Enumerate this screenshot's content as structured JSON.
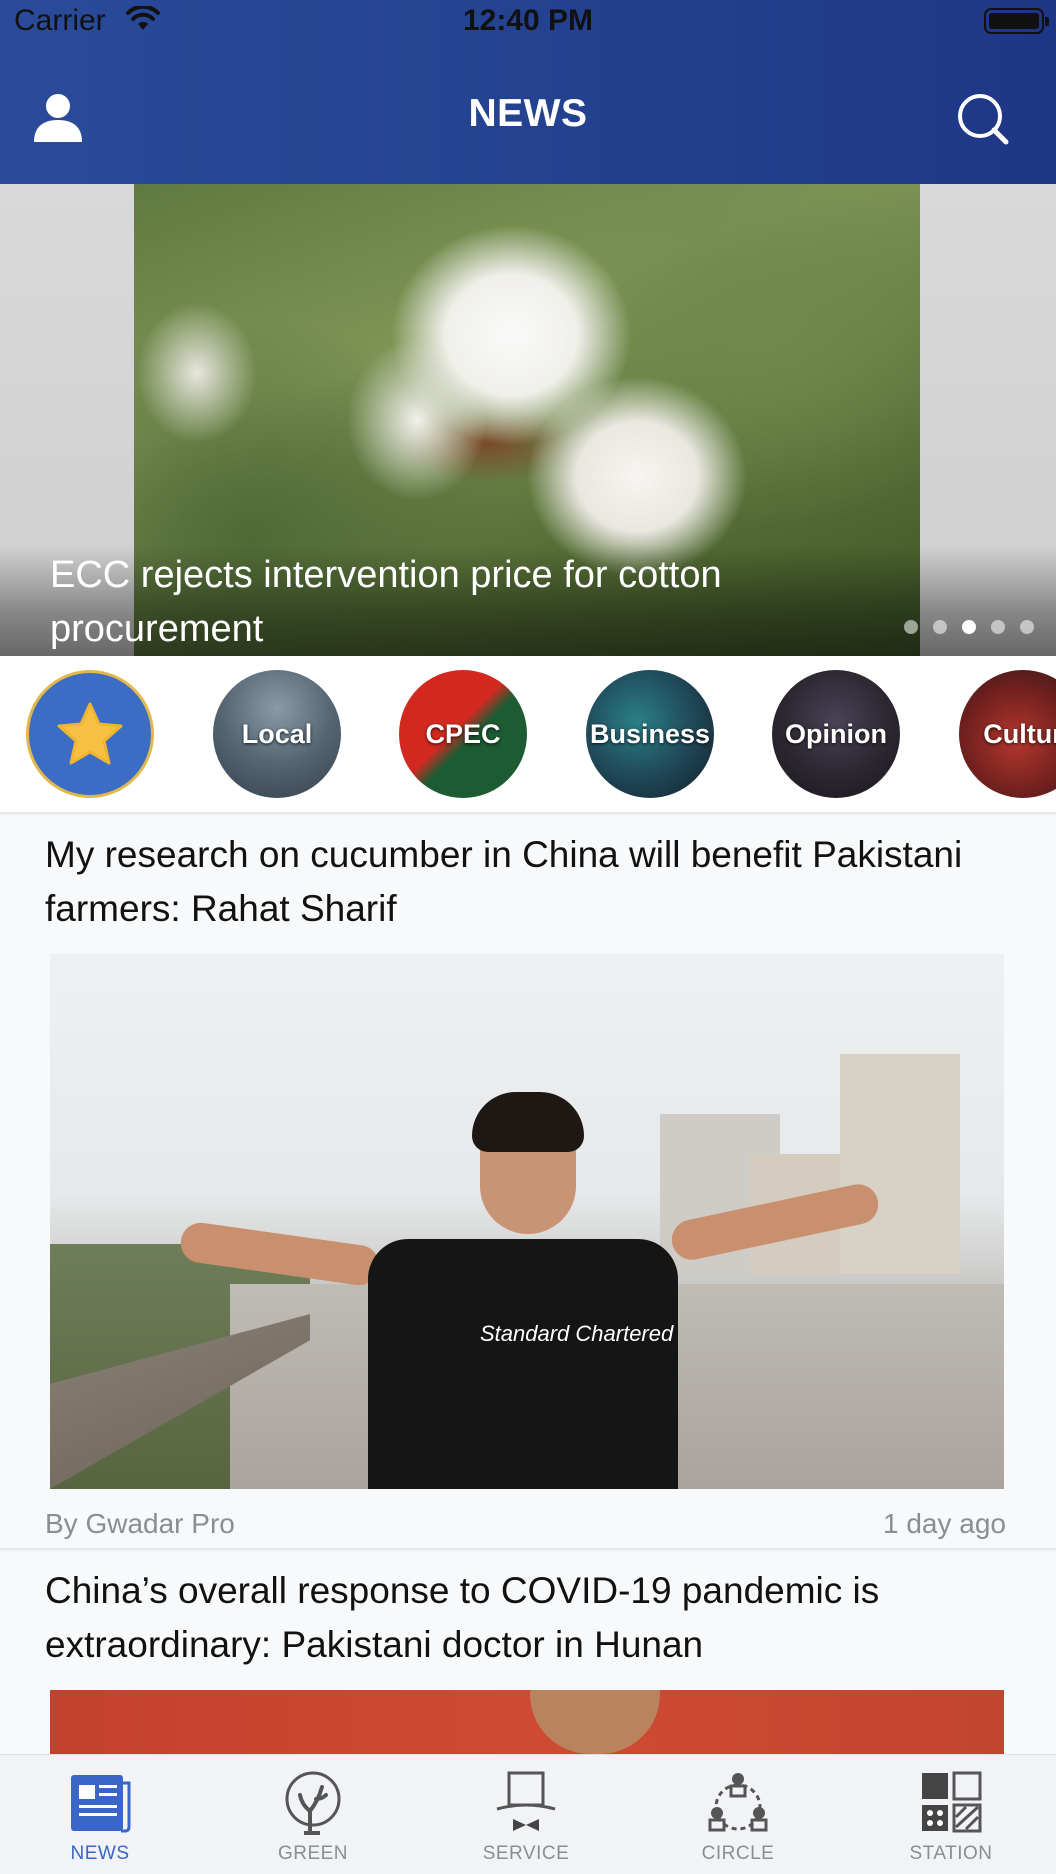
{
  "status_bar": {
    "carrier": "Carrier",
    "time": "12:40 PM"
  },
  "nav": {
    "title": "NEWS",
    "left_icon": "user-icon",
    "right_icon": "search-icon"
  },
  "carousel": {
    "caption": "ECC rejects intervention price for cotton procurement",
    "page_count": 5,
    "active_index": 2
  },
  "categories": [
    {
      "label": "",
      "icon": "star-icon"
    },
    {
      "label": "Local"
    },
    {
      "label": "CPEC"
    },
    {
      "label": "Business"
    },
    {
      "label": "Opinion"
    },
    {
      "label": "Cultur"
    }
  ],
  "articles": [
    {
      "title": "My research on cucumber in China will benefit Pakistani farmers: Rahat Sharif",
      "image_text": "Standard Chartered",
      "author": "By Gwadar Pro",
      "time": "1 day ago"
    },
    {
      "title": "China’s overall response to COVID-19 pandemic is extraordinary: Pakistani doctor in Hunan"
    }
  ],
  "tabs": [
    {
      "label": "NEWS",
      "icon": "newspaper-icon",
      "active": true
    },
    {
      "label": "GREEN",
      "icon": "tree-icon",
      "active": false
    },
    {
      "label": "SERVICE",
      "icon": "butler-hat-icon",
      "active": false
    },
    {
      "label": "CIRCLE",
      "icon": "people-circle-icon",
      "active": false
    },
    {
      "label": "STATION",
      "icon": "grid-icon",
      "active": false
    }
  ],
  "colors": {
    "nav_background": "#23418f",
    "tab_active": "#3a66c9",
    "tab_inactive": "#8a8d92",
    "favorite_ring": "#e2b84a",
    "star": "#f6c143"
  }
}
